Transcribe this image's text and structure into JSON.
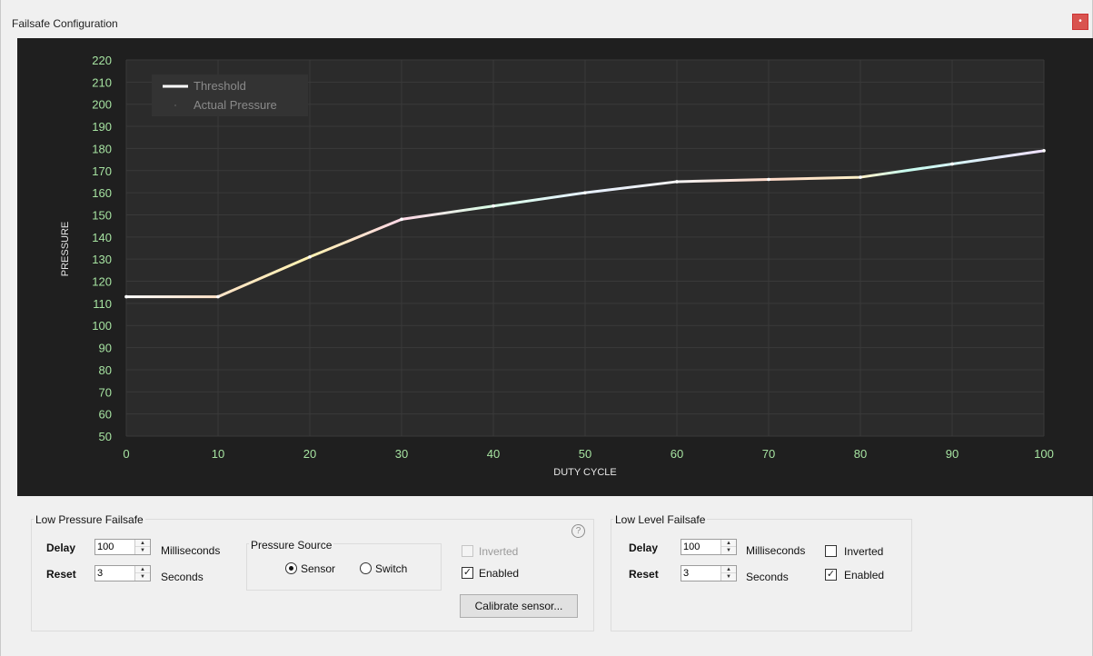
{
  "window": {
    "title": "Failsafe Configuration",
    "close_glyph": "•"
  },
  "chart_data": {
    "type": "line",
    "xlabel": "DUTY CYCLE",
    "ylabel": "PRESSURE",
    "xlim": [
      0,
      100
    ],
    "ylim": [
      50,
      220
    ],
    "x_ticks": [
      0,
      10,
      20,
      30,
      40,
      50,
      60,
      70,
      80,
      90,
      100
    ],
    "y_ticks": [
      50,
      60,
      70,
      80,
      90,
      100,
      110,
      120,
      130,
      140,
      150,
      160,
      170,
      180,
      190,
      200,
      210,
      220
    ],
    "grid": true,
    "legend": {
      "placement": "top-left",
      "entries": [
        "Threshold",
        "Actual Pressure"
      ]
    },
    "series": [
      {
        "name": "Threshold",
        "x": [
          0,
          10,
          20,
          30,
          40,
          50,
          60,
          70,
          80,
          90,
          100
        ],
        "y": [
          113,
          113,
          131,
          148,
          154,
          160,
          165,
          166,
          167,
          173,
          179
        ]
      },
      {
        "name": "Actual Pressure",
        "x": [],
        "y": []
      }
    ],
    "colors": {
      "background": "#1f1f1f",
      "plot_area": "#2b2b2b",
      "grid": "#3a3a3a",
      "tick_label": "#a6e3a1",
      "axis_title": "#e8e8e8",
      "legend_text": "#8a8a8a"
    }
  },
  "low_pressure": {
    "title": "Low Pressure Failsafe",
    "delay_label": "Delay",
    "delay_value": "100",
    "delay_unit": "Milliseconds",
    "reset_label": "Reset",
    "reset_value": "3",
    "reset_unit": "Seconds",
    "source": {
      "title": "Pressure Source",
      "sensor_label": "Sensor",
      "switch_label": "Switch",
      "selected": "Sensor"
    },
    "inverted_label": "Inverted",
    "inverted_checked": false,
    "inverted_disabled": true,
    "enabled_label": "Enabled",
    "enabled_checked": true,
    "calibrate_label": "Calibrate sensor...",
    "help_glyph": "?"
  },
  "low_level": {
    "title": "Low Level Failsafe",
    "delay_label": "Delay",
    "delay_value": "100",
    "delay_unit": "Milliseconds",
    "reset_label": "Reset",
    "reset_value": "3",
    "reset_unit": "Seconds",
    "inverted_label": "Inverted",
    "inverted_checked": false,
    "enabled_label": "Enabled",
    "enabled_checked": true
  },
  "glyphs": {
    "check": "✓",
    "spin_up": "▲",
    "spin_down": "▼"
  }
}
